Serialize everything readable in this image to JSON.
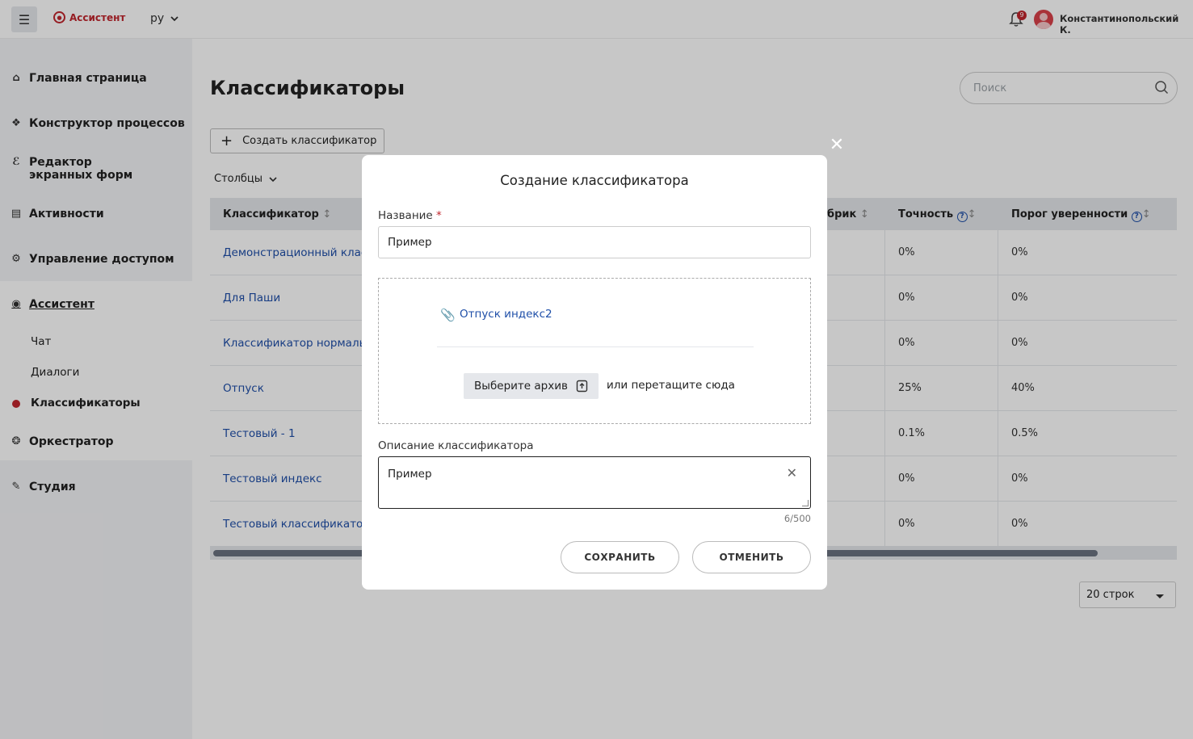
{
  "header": {
    "brand": "Ассистент",
    "language": "ру",
    "notifications_count": "9",
    "user_name": "Константинопольский К."
  },
  "sidebar": {
    "items": [
      {
        "label": "Главная страница",
        "icon": "home-icon"
      },
      {
        "label": "Конструктор процессов",
        "icon": "flow-icon"
      },
      {
        "label": "Редактор экранных форм",
        "icon": "form-editor-icon"
      },
      {
        "label": "Активности",
        "icon": "activity-icon"
      },
      {
        "label": "Управление доступом",
        "icon": "access-icon"
      },
      {
        "label": "Ассистент",
        "icon": "assistant-icon"
      },
      {
        "label": "Оркестратор",
        "icon": "orchestrator-icon"
      },
      {
        "label": "Студия",
        "icon": "studio-icon"
      }
    ],
    "sub_items": [
      "Чат",
      "Диалоги",
      "Классификаторы"
    ]
  },
  "main": {
    "title": "Классификаторы",
    "search_placeholder": "Поиск",
    "create_button": "Создать классификатор",
    "columns_button": "Столбцы",
    "table": {
      "headers": [
        "Классификатор",
        "брик",
        "Точность",
        "Порог уверенности"
      ],
      "rows": [
        {
          "name": "Демонстрационный клас",
          "accuracy": "0%",
          "threshold": "0%"
        },
        {
          "name": "Для Паши",
          "accuracy": "0%",
          "threshold": "0%"
        },
        {
          "name": "Классификатор нормальн",
          "accuracy": "0%",
          "threshold": "0%"
        },
        {
          "name": "Отпуск",
          "accuracy": "25%",
          "threshold": "40%"
        },
        {
          "name": "Тестовый - 1",
          "accuracy": "0.1%",
          "threshold": "0.5%"
        },
        {
          "name": "Тестовый индекс",
          "accuracy": "0%",
          "threshold": "0%"
        },
        {
          "name": "Тестовый классификатор",
          "accuracy": "0%",
          "threshold": "0%"
        }
      ]
    },
    "rows_per_page": "20 строк"
  },
  "modal": {
    "title": "Создание классификатора",
    "name_label": "Название",
    "name_required": "*",
    "name_value": "Пример",
    "file_name": "Отпуск индекс2",
    "choose_button": "Выберите архив",
    "drag_text": "или перетащите сюда",
    "description_label": "Описание классификатора",
    "description_value": "Пример",
    "counter": "6/500",
    "save_button": "СОХРАНИТЬ",
    "cancel_button": "ОТМЕНИТЬ"
  },
  "colors": {
    "brand": "#c0262d",
    "link": "#1f4fa8"
  }
}
